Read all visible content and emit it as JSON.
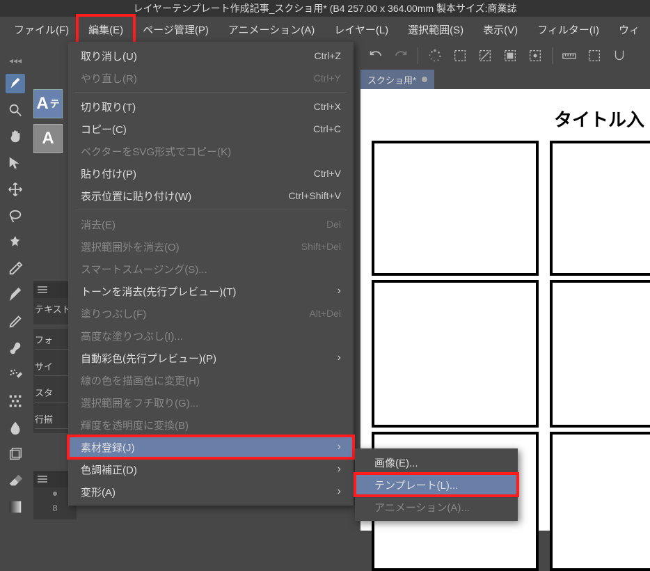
{
  "title_bar": "レイヤーテンプレート作成記事_スクショ用*  (B4 257.00 x 364.00mm 製本サイズ:商業誌",
  "menu_bar": {
    "file": "ファイル(F)",
    "edit": "編集(E)",
    "page": "ページ管理(P)",
    "animation": "アニメーション(A)",
    "layer": "レイヤー(L)",
    "selection": "選択範囲(S)",
    "view": "表示(V)",
    "filter": "フィルター(I)",
    "window": "ウィ"
  },
  "doc_tab": {
    "label": "スクショ用*",
    "dirty": "●"
  },
  "canvas": {
    "title": "タイトル入"
  },
  "text_panel": {
    "label1": "テキスト",
    "r0": "フォ",
    "r1": "サイ",
    "r2": "スタ",
    "r3": "行揃"
  },
  "panel3": {
    "num": "8"
  },
  "edit_menu": {
    "items": [
      {
        "label": "取り消し(U)",
        "shortcut": "Ctrl+Z",
        "disabled": false
      },
      {
        "label": "やり直し(R)",
        "shortcut": "Ctrl+Y",
        "disabled": true
      },
      {
        "sep": true
      },
      {
        "label": "切り取り(T)",
        "shortcut": "Ctrl+X",
        "disabled": false
      },
      {
        "label": "コピー(C)",
        "shortcut": "Ctrl+C",
        "disabled": false
      },
      {
        "label": "ベクターをSVG形式でコピー(K)",
        "shortcut": "",
        "disabled": true
      },
      {
        "label": "貼り付け(P)",
        "shortcut": "Ctrl+V",
        "disabled": false
      },
      {
        "label": "表示位置に貼り付け(W)",
        "shortcut": "Ctrl+Shift+V",
        "disabled": false
      },
      {
        "sep": true
      },
      {
        "label": "消去(E)",
        "shortcut": "Del",
        "disabled": true
      },
      {
        "label": "選択範囲外を消去(O)",
        "shortcut": "Shift+Del",
        "disabled": true
      },
      {
        "label": "スマートスムージング(S)...",
        "shortcut": "",
        "disabled": true
      },
      {
        "label": "トーンを消去(先行プレビュー)(T)",
        "shortcut": "",
        "disabled": false,
        "arrow": true
      },
      {
        "label": "塗りつぶし(F)",
        "shortcut": "Alt+Del",
        "disabled": true
      },
      {
        "label": "高度な塗りつぶし(I)...",
        "shortcut": "",
        "disabled": true
      },
      {
        "label": "自動彩色(先行プレビュー)(P)",
        "shortcut": "",
        "disabled": false,
        "arrow": true
      },
      {
        "label": "線の色を描画色に変更(H)",
        "shortcut": "",
        "disabled": true
      },
      {
        "label": "選択範囲をフチ取り(G)...",
        "shortcut": "",
        "disabled": true
      },
      {
        "label": "輝度を透明度に変換(B)",
        "shortcut": "",
        "disabled": true
      },
      {
        "label": "素材登録(J)",
        "shortcut": "",
        "disabled": false,
        "arrow": true,
        "hover": true,
        "red": true
      },
      {
        "label": "色調補正(D)",
        "shortcut": "",
        "disabled": false,
        "arrow": true
      },
      {
        "label": "変形(A)",
        "shortcut": "",
        "disabled": false,
        "arrow": true
      }
    ]
  },
  "submenu": {
    "items": [
      {
        "label": "画像(E)...",
        "disabled": false
      },
      {
        "label": "テンプレート(L)...",
        "disabled": false,
        "hover": true,
        "red": true
      },
      {
        "label": "アニメーション(A)...",
        "disabled": true
      }
    ]
  }
}
